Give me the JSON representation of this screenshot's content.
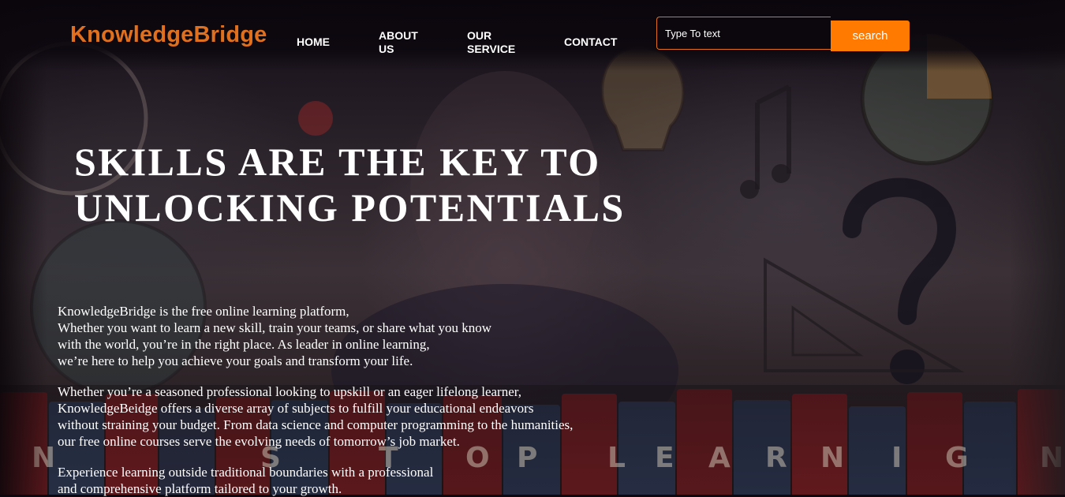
{
  "nav": {
    "logo": "KnowledgeBridge",
    "items": [
      {
        "label": "HOME"
      },
      {
        "label": "ABOUT\nUS"
      },
      {
        "label": "OUR\nSERVICE"
      },
      {
        "label": "CONTACT"
      }
    ],
    "search": {
      "placeholder": "Type To text",
      "button_label": "search"
    }
  },
  "hero": {
    "headline_line1": "SKILLS ARE THE KEY TO",
    "headline_line2": "UNLOCKING POTENTIALS",
    "paragraphs": [
      "KnowledgeBridge is the free online learning platform,\nWhether you want to learn a new skill, train your teams, or share what you know\nwith the world, you’re in the right place. As leader in online learning,\nwe’re here to help you achieve your goals and transform your life.",
      "Whether you’re a seasoned professional looking to upskill or an eager lifelong learner,\nKnowledgeBeidge offers a diverse array of subjects to fulfill your educational endeavors\nwithout straining your budget. From data science and computer programming to the humanities,\nour free online courses serve the evolving needs of tomorrow’s job market.",
      "Experience learning outside traditional boundaries with a professional\nand comprehensive platform tailored to your growth."
    ],
    "book_letters": [
      "N",
      "S",
      "T",
      "O",
      "P",
      "L",
      "E",
      "A",
      "R",
      "N",
      "I",
      "G",
      "N"
    ]
  },
  "colors": {
    "accent": "#ff7a00",
    "logo": "#e0701d",
    "background": "#0d0810",
    "text": "#ffffff"
  }
}
